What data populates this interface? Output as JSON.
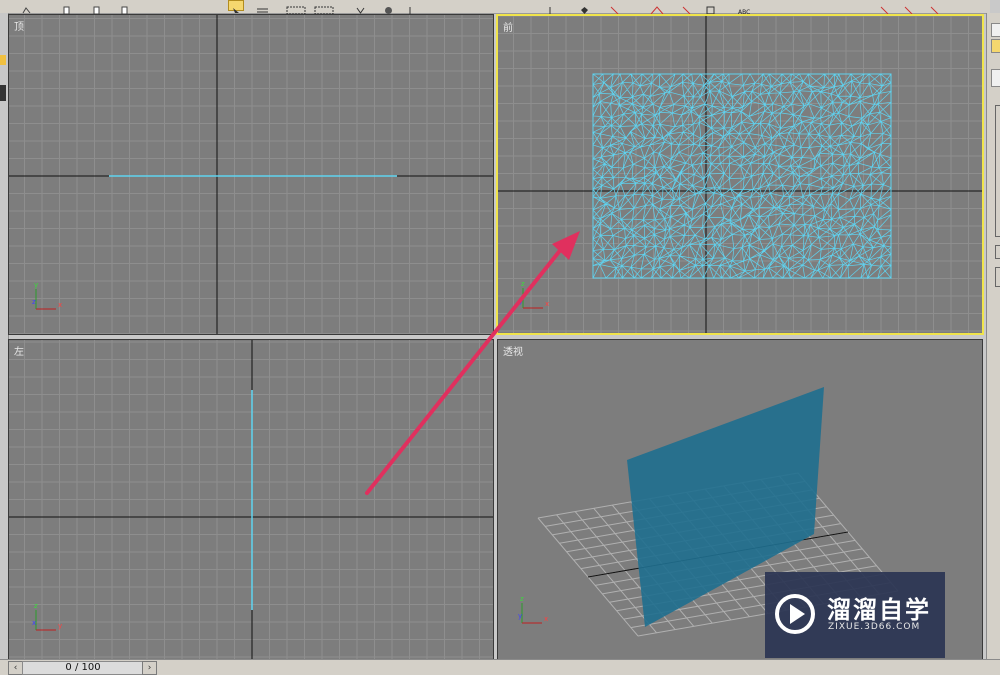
{
  "viewports": {
    "top": {
      "label": "顶"
    },
    "front": {
      "label": "前"
    },
    "left": {
      "label": "左"
    },
    "perspective": {
      "label": "透视"
    }
  },
  "axes": {
    "top": {
      "v": "y",
      "h": "x",
      "d": "z"
    },
    "front": {
      "v": "z",
      "h": "x",
      "d": "y"
    },
    "left": {
      "v": "z",
      "h": "y",
      "d": "x"
    },
    "perspective": {
      "v": "z",
      "h": "x",
      "d": "y"
    }
  },
  "statusbar": {
    "frame_counter": "0 / 100",
    "prev_icon": "‹",
    "next_icon": "›"
  },
  "watermark": {
    "title": "溜溜自学",
    "url": "ZIXUE.3D66.COM"
  },
  "colors": {
    "viewport_bg": "#7d7d7d",
    "grid": "#8e8e8e",
    "active_border": "#f0e44a",
    "mesh": "#5fd3f0",
    "plane_fill": "#1f6f8f",
    "arrow": "#e0305e"
  },
  "toolbar": {
    "icons": [
      "undo-icon",
      "redo-icon",
      "select-icon",
      "select-by-name-icon",
      "rect-select-icon",
      "window-crossing-icon",
      "move-icon",
      "rotate-icon",
      "scale-icon",
      "mirror-icon",
      "align-icon",
      "spell-icon"
    ]
  }
}
